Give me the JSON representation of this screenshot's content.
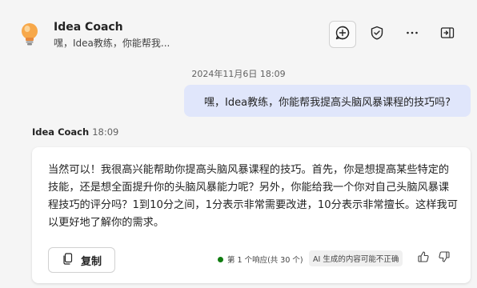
{
  "header": {
    "bot_name": "Idea Coach",
    "preview": "嘿，Idea教练，你能帮我...",
    "icons": [
      "lightbulb-icon",
      "new-chat-icon",
      "shield-check-icon",
      "more-icon",
      "sidebar-toggle-icon"
    ]
  },
  "conversation": {
    "timestamp": "2024年11月6日 18:09",
    "user_message": "嘿，Idea教练，你能帮我提高头脑风暴课程的技巧吗?",
    "bot_name": "Idea Coach",
    "bot_time": "18:09",
    "bot_message": "当然可以！我很高兴能帮助你提高头脑风暴课程的技巧。首先，你是想提高某些特定的技能，还是想全面提升你的头脑风暴能力呢？另外，你能给我一个你对自己头脑风暴课程技巧的评分吗？1到10分之间，1分表示非常需要改进，10分表示非常擅长。这样我可以更好地了解你的需求。",
    "copy_label": "复制",
    "response_count": "第 1 个响应(共 30 个)",
    "ai_disclaimer": "AI 生成的内容可能不正确"
  },
  "colors": {
    "background": "#f5f5f5",
    "user_bubble": "#e0e6fb",
    "card": "#ffffff",
    "status_dot": "#107c10"
  }
}
